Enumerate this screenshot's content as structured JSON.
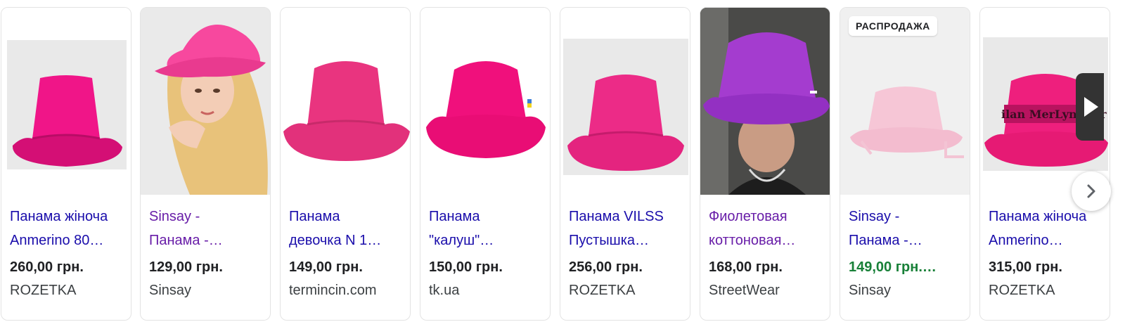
{
  "carousel": {
    "items": [
      {
        "title_line1": "Панама жіноча",
        "title_line2": "Anmerino 80…",
        "price": "260,00 грн.",
        "store": "ROZETKA",
        "hat_color": "#f01588",
        "badge": ""
      },
      {
        "title_line1": "Sinsay -",
        "title_line2": "Панама -…",
        "price": "129,00 грн.",
        "store": "Sinsay",
        "hat_color": "#f7489e",
        "badge": ""
      },
      {
        "title_line1": "Панама",
        "title_line2": "девочка N 1…",
        "price": "149,00 грн.",
        "store": "termincin.com",
        "hat_color": "#e9347f",
        "badge": ""
      },
      {
        "title_line1": "Панама",
        "title_line2": "\"калуш\"…",
        "price": "150,00 грн.",
        "store": "tk.ua",
        "hat_color": "#f0107c",
        "badge": ""
      },
      {
        "title_line1": "Панама VILSS",
        "title_line2": "Пустышка…",
        "price": "256,00 грн.",
        "store": "ROZETKA",
        "hat_color": "#ec2b87",
        "badge": ""
      },
      {
        "title_line1": "Фиолетовая",
        "title_line2": "коттоновая…",
        "price": "168,00 грн.",
        "store": "StreetWear",
        "hat_color": "#a43ccf",
        "badge": ""
      },
      {
        "title_line1": "Sinsay -",
        "title_line2": "Панама -…",
        "price": "149,00 грн.…",
        "store": "Sinsay",
        "hat_color": "#f6c6d6",
        "badge": "РАСПРОДАЖА"
      },
      {
        "title_line1": "Панама жіноча",
        "title_line2": "Anmerino…",
        "price": "315,00 грн.",
        "store": "ROZETKA",
        "hat_color": "#ee1f7d",
        "badge": "",
        "hat_text": "ilan MerLyn Mer"
      }
    ]
  },
  "colors": {
    "link": "#1a0dab",
    "visited_link": "#681da8",
    "sale_price": "#188038",
    "text": "#202124"
  }
}
